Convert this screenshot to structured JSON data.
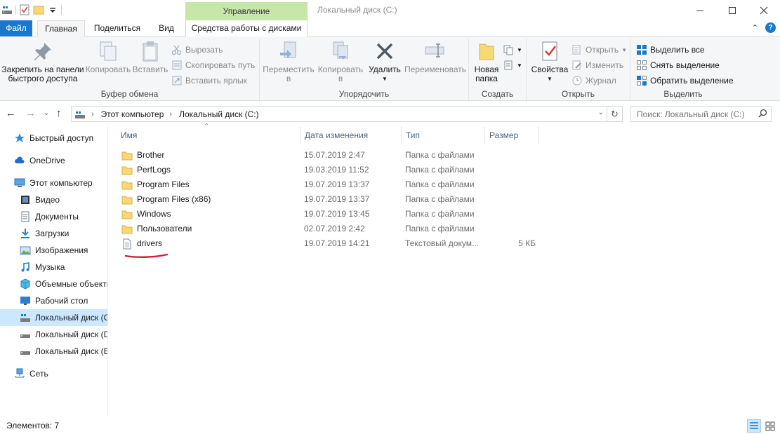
{
  "window": {
    "title": "Локальный диск (C:)",
    "contextual_tab_group": "Управление"
  },
  "tabs": {
    "file": "Файл",
    "home": "Главная",
    "share": "Поделиться",
    "view": "Вид",
    "drive_tools": "Средства работы с дисками"
  },
  "ribbon": {
    "clipboard": {
      "label": "Буфер обмена",
      "pin_line1": "Закрепить на панели",
      "pin_line2": "быстрого доступа",
      "copy": "Копировать",
      "paste": "Вставить",
      "cut": "Вырезать",
      "copy_path": "Скопировать путь",
      "paste_shortcut": "Вставить ярлык"
    },
    "organize": {
      "label": "Упорядочить",
      "move_line1": "Переместить",
      "move_line2": "в",
      "copy_line1": "Копировать",
      "copy_line2": "в",
      "delete": "Удалить",
      "rename": "Переименовать"
    },
    "new": {
      "label": "Создать",
      "folder_line1": "Новая",
      "folder_line2": "папка"
    },
    "open": {
      "label": "Открыть",
      "properties": "Свойства",
      "open": "Открыть",
      "edit": "Изменить",
      "history": "Журнал"
    },
    "select": {
      "label": "Выделить",
      "select_all": "Выделить все",
      "select_none": "Снять выделение",
      "invert": "Обратить выделение"
    }
  },
  "address": {
    "crumbs": [
      "Этот компьютер",
      "Локальный диск (C:)"
    ],
    "search_placeholder": "Поиск: Локальный диск (C:)"
  },
  "navpane": {
    "items": [
      {
        "label": "Быстрый доступ",
        "icon": "star-icon"
      },
      {
        "label": "OneDrive",
        "icon": "cloud-icon"
      },
      {
        "label": "Этот компьютер",
        "icon": "computer-icon"
      },
      {
        "label": "Видео",
        "icon": "video-icon"
      },
      {
        "label": "Документы",
        "icon": "document-icon"
      },
      {
        "label": "Загрузки",
        "icon": "download-icon"
      },
      {
        "label": "Изображения",
        "icon": "pictures-icon"
      },
      {
        "label": "Музыка",
        "icon": "music-icon"
      },
      {
        "label": "Объемные объекты",
        "icon": "3d-objects-icon"
      },
      {
        "label": "Рабочий стол",
        "icon": "desktop-icon"
      },
      {
        "label": "Локальный диск (C:)",
        "icon": "system-drive-icon"
      },
      {
        "label": "Локальный диск (D:)",
        "icon": "drive-icon"
      },
      {
        "label": "Локальный диск (E:)",
        "icon": "drive-icon"
      },
      {
        "label": "Сеть",
        "icon": "network-icon"
      }
    ]
  },
  "filelist": {
    "columns": {
      "name": "Имя",
      "date": "Дата изменения",
      "type": "Тип",
      "size": "Размер"
    },
    "rows": [
      {
        "name": "Brother",
        "date": "15.07.2019 2:47",
        "type": "Папка с файлами",
        "size": "",
        "icon": "folder-icon"
      },
      {
        "name": "PerfLogs",
        "date": "19.03.2019 11:52",
        "type": "Папка с файлами",
        "size": "",
        "icon": "folder-icon"
      },
      {
        "name": "Program Files",
        "date": "19.07.2019 13:37",
        "type": "Папка с файлами",
        "size": "",
        "icon": "folder-icon"
      },
      {
        "name": "Program Files (x86)",
        "date": "19.07.2019 13:37",
        "type": "Папка с файлами",
        "size": "",
        "icon": "folder-icon"
      },
      {
        "name": "Windows",
        "date": "19.07.2019 13:45",
        "type": "Папка с файлами",
        "size": "",
        "icon": "folder-icon"
      },
      {
        "name": "Пользователи",
        "date": "02.07.2019 2:42",
        "type": "Папка с файлами",
        "size": "",
        "icon": "folder-icon"
      },
      {
        "name": "drivers",
        "date": "19.07.2019 14:21",
        "type": "Текстовый докум...",
        "size": "5 КБ",
        "icon": "text-file-icon"
      }
    ]
  },
  "status": {
    "count": "Элементов: 7"
  },
  "colors": {
    "accent": "#1979ca",
    "context_tab": "#c8e6a8",
    "selection": "#cce8ff",
    "folder": "#f8d775",
    "annotation_underline": "#d01f2f"
  }
}
